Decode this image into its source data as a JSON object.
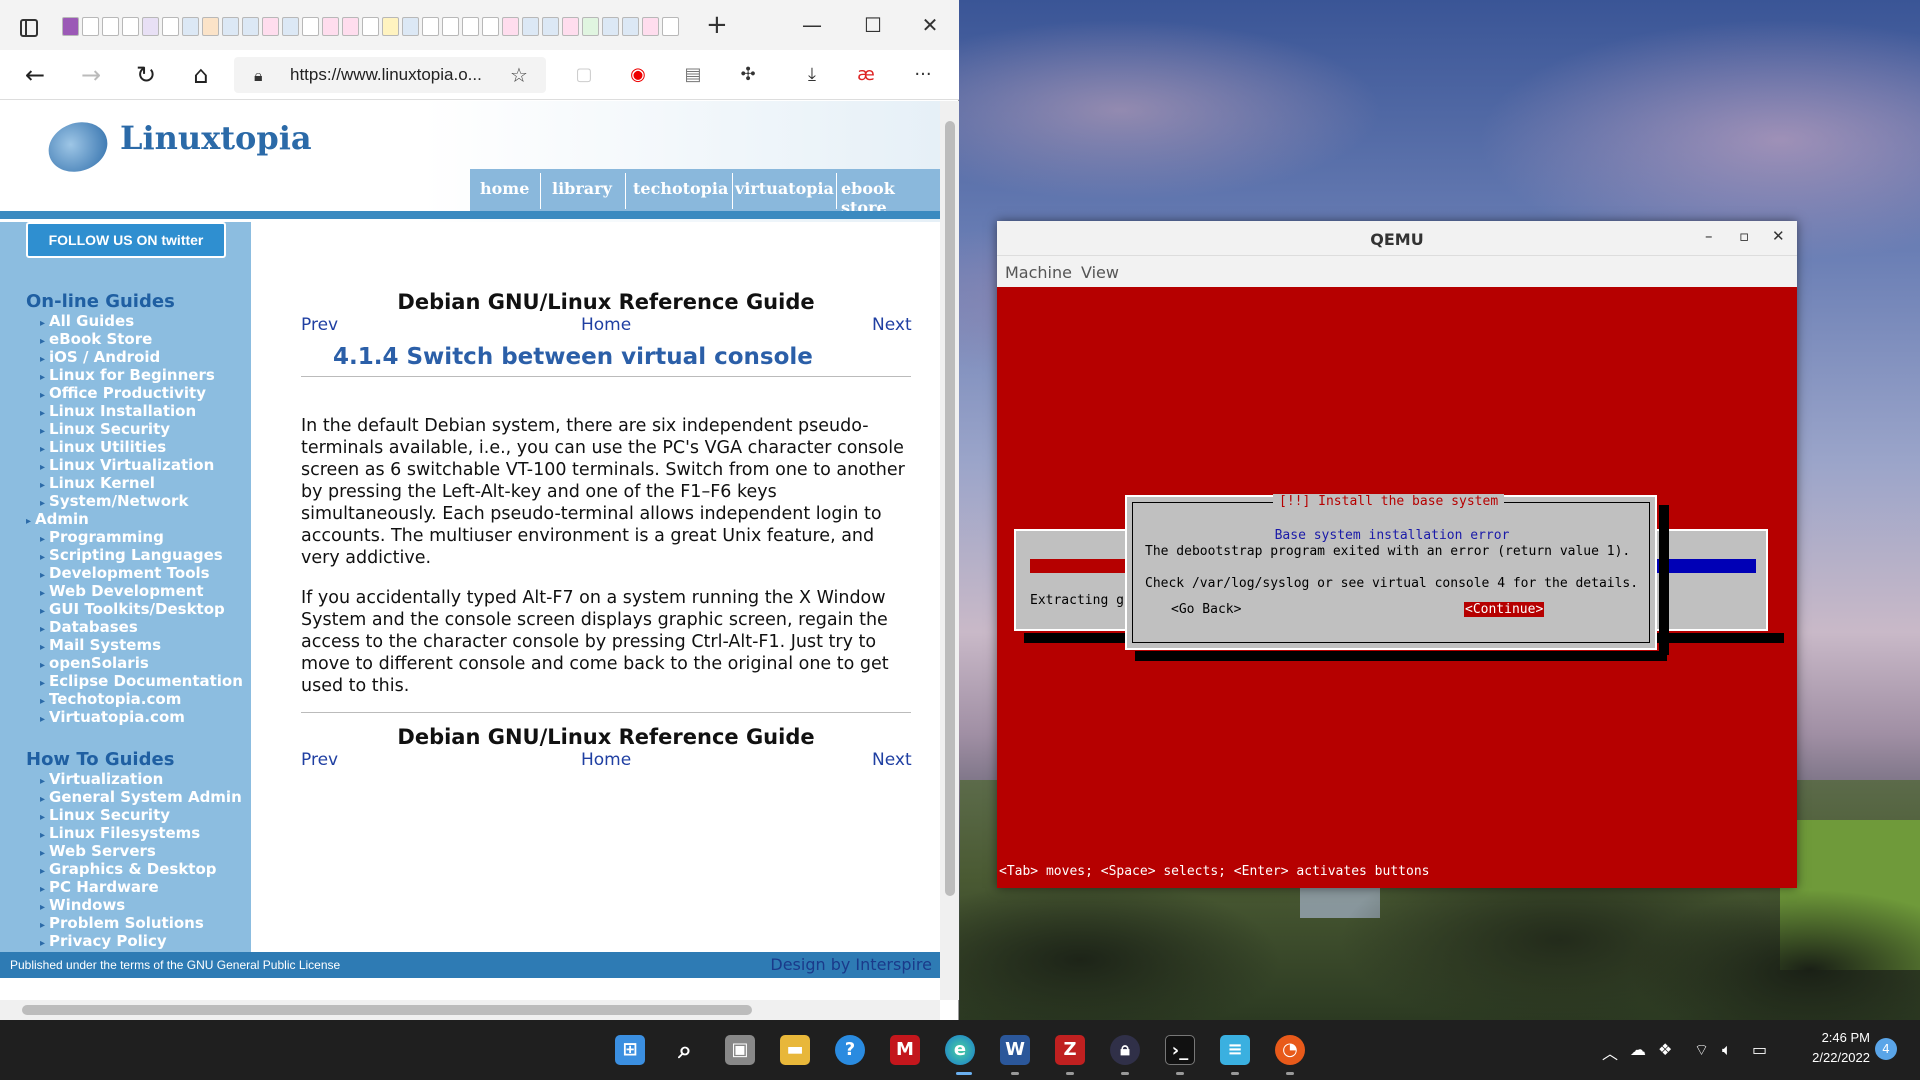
{
  "browser": {
    "new_tab": "+",
    "minimize": "—",
    "maximize": "☐",
    "close": "✕",
    "url": "https://www.linuxtopia.o...",
    "more": "···"
  },
  "site": {
    "logo": "Linuxtopia",
    "nav": [
      "home",
      "library",
      "techotopia",
      "virtuatopia",
      "ebook store"
    ],
    "twitter": "FOLLOW US ON twitter",
    "sections": [
      {
        "title": "On-line Guides",
        "links": [
          "All Guides",
          "eBook Store",
          "iOS / Android",
          "Linux for Beginners",
          "Office Productivity",
          "Linux Installation",
          "Linux Security",
          "Linux Utilities",
          "Linux Virtualization",
          "Linux Kernel",
          "System/Network",
          "Programming",
          "Scripting Languages",
          "Development Tools",
          "Web Development",
          "GUI Toolkits/Desktop",
          "Databases",
          "Mail Systems",
          "openSolaris",
          "Eclipse Documentation",
          "Techotopia.com",
          "Virtuatopia.com"
        ],
        "wrap": "Admin"
      },
      {
        "title": "How To Guides",
        "links": [
          "Virtualization",
          "General System Admin",
          "Linux Security",
          "Linux Filesystems",
          "Web Servers",
          "Graphics & Desktop",
          "PC Hardware",
          "Windows",
          "Problem Solutions",
          "Privacy Policy"
        ]
      }
    ],
    "guide_title": "Debian GNU/Linux Reference Guide",
    "prev": "Prev",
    "home": "Home",
    "next": "Next",
    "section_title": "4.1.4 Switch between virtual console",
    "para1": "In the default Debian system, there are six independent pseudo-terminals available, i.e., you can use the PC's VGA character console screen as 6 switchable VT-100 terminals. Switch from one to another by pressing the Left-Alt-key and one of the F1–F6 keys simultaneously. Each pseudo-terminal allows independent login to accounts. The multiuser environment is a great Unix feature, and very addictive.",
    "para2": "If you accidentally typed Alt-F7 on a system running the X Window System and the console screen displays graphic screen, regain the access to the character console by pressing Ctrl-Alt-F1. Just try to move to different console and come back to the original one to get used to this.",
    "footer_left": "Published under the terms of the GNU General Public License",
    "footer_right": "Design by Interspire"
  },
  "qemu": {
    "title": "QEMU",
    "min": "–",
    "max": "▫",
    "close": "✕",
    "menu": [
      "Machine",
      "View"
    ],
    "progress_text": "Extracting g",
    "dialog_title": "[!!] Install the base system",
    "dialog_subtitle": "Base system installation error",
    "dialog_line1": "The debootstrap program exited with an error (return value 1).",
    "dialog_line2": "Check /var/log/syslog or see virtual console 4 for the details.",
    "go_back": "<Go Back>",
    "continue": "<Continue>",
    "status": "<Tab> moves; <Space> selects; <Enter> activates buttons"
  },
  "taskbar": {
    "time": "2:46 PM",
    "date": "2/22/2022",
    "notifications": "4"
  }
}
